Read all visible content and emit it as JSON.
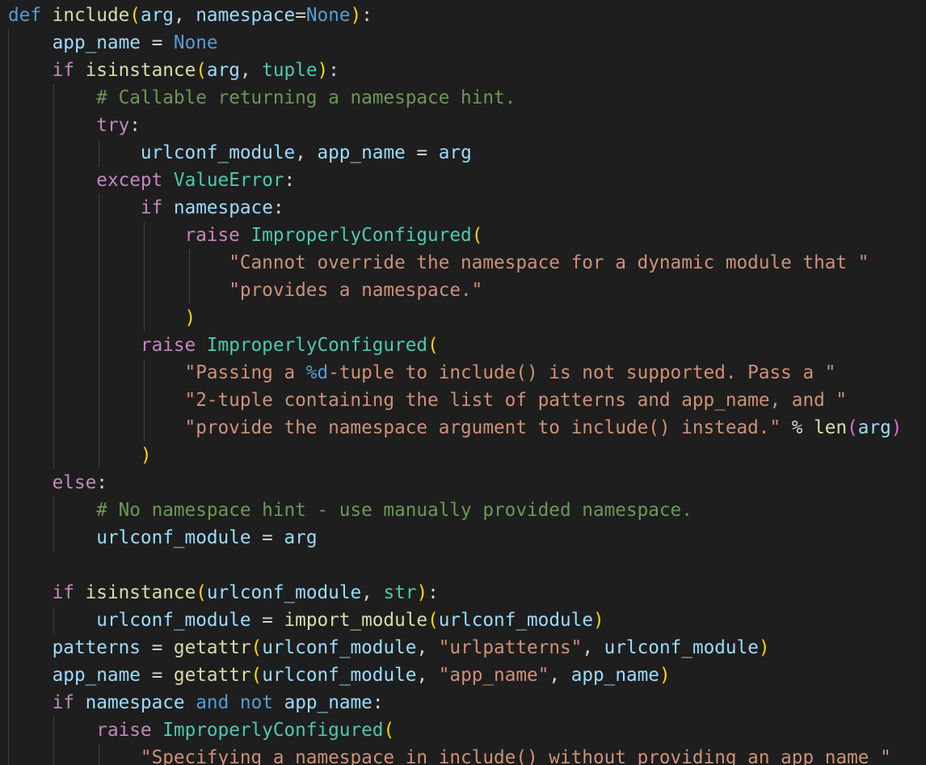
{
  "editor": {
    "language": "python",
    "theme_colors": {
      "background": "#1e1e1e",
      "default": "#d4d4d4",
      "keyword": "#569cd6",
      "control": "#c586c0",
      "function": "#dcdcaa",
      "variable": "#9cdcfe",
      "string": "#ce9178",
      "class": "#4ec9b0",
      "comment": "#6a9955",
      "bracket_level_1": "#ffd700",
      "bracket_level_2": "#da70d6",
      "indent_guide": "#404040"
    },
    "lines": [
      {
        "tokens": [
          {
            "t": "def",
            "c": "kw"
          },
          {
            "t": " "
          },
          {
            "t": "include",
            "c": "fn"
          },
          {
            "t": "(",
            "c": "b1"
          },
          {
            "t": "arg",
            "c": "var"
          },
          {
            "t": ", "
          },
          {
            "t": "namespace",
            "c": "var"
          },
          {
            "t": "="
          },
          {
            "t": "None",
            "c": "kw"
          },
          {
            "t": ")",
            "c": "b1"
          },
          {
            "t": ":"
          }
        ]
      },
      {
        "tokens": [
          {
            "t": "    "
          },
          {
            "t": "app_name",
            "c": "var"
          },
          {
            "t": " = "
          },
          {
            "t": "None",
            "c": "kw"
          }
        ]
      },
      {
        "tokens": [
          {
            "t": "    "
          },
          {
            "t": "if",
            "c": "ctrl"
          },
          {
            "t": " "
          },
          {
            "t": "isinstance",
            "c": "fn"
          },
          {
            "t": "(",
            "c": "b1"
          },
          {
            "t": "arg",
            "c": "var"
          },
          {
            "t": ", "
          },
          {
            "t": "tuple",
            "c": "cls"
          },
          {
            "t": ")",
            "c": "b1"
          },
          {
            "t": ":"
          }
        ]
      },
      {
        "tokens": [
          {
            "t": "        "
          },
          {
            "t": "# Callable returning a namespace hint.",
            "c": "cm"
          }
        ]
      },
      {
        "tokens": [
          {
            "t": "        "
          },
          {
            "t": "try",
            "c": "ctrl"
          },
          {
            "t": ":"
          }
        ]
      },
      {
        "tokens": [
          {
            "t": "            "
          },
          {
            "t": "urlconf_module",
            "c": "var"
          },
          {
            "t": ", "
          },
          {
            "t": "app_name",
            "c": "var"
          },
          {
            "t": " = "
          },
          {
            "t": "arg",
            "c": "var"
          }
        ]
      },
      {
        "tokens": [
          {
            "t": "        "
          },
          {
            "t": "except",
            "c": "ctrl"
          },
          {
            "t": " "
          },
          {
            "t": "ValueError",
            "c": "cls"
          },
          {
            "t": ":"
          }
        ]
      },
      {
        "tokens": [
          {
            "t": "            "
          },
          {
            "t": "if",
            "c": "ctrl"
          },
          {
            "t": " "
          },
          {
            "t": "namespace",
            "c": "var"
          },
          {
            "t": ":"
          }
        ]
      },
      {
        "tokens": [
          {
            "t": "                "
          },
          {
            "t": "raise",
            "c": "ctrl"
          },
          {
            "t": " "
          },
          {
            "t": "ImproperlyConfigured",
            "c": "cls"
          },
          {
            "t": "(",
            "c": "b1"
          }
        ]
      },
      {
        "tokens": [
          {
            "t": "                    "
          },
          {
            "t": "\"Cannot override the namespace for a dynamic module that \"",
            "c": "str"
          }
        ]
      },
      {
        "tokens": [
          {
            "t": "                    "
          },
          {
            "t": "\"provides a namespace.\"",
            "c": "str"
          }
        ]
      },
      {
        "tokens": [
          {
            "t": "                "
          },
          {
            "t": ")",
            "c": "b1"
          }
        ]
      },
      {
        "tokens": [
          {
            "t": "            "
          },
          {
            "t": "raise",
            "c": "ctrl"
          },
          {
            "t": " "
          },
          {
            "t": "ImproperlyConfigured",
            "c": "cls"
          },
          {
            "t": "(",
            "c": "b1"
          }
        ]
      },
      {
        "tokens": [
          {
            "t": "                "
          },
          {
            "t": "\"Passing a ",
            "c": "str"
          },
          {
            "t": "%d",
            "c": "kw"
          },
          {
            "t": "-tuple to include() is not supported. Pass a \"",
            "c": "str"
          }
        ]
      },
      {
        "tokens": [
          {
            "t": "                "
          },
          {
            "t": "\"2-tuple containing the list of patterns and app_name, and \"",
            "c": "str"
          }
        ]
      },
      {
        "tokens": [
          {
            "t": "                "
          },
          {
            "t": "\"provide the namespace argument to include() instead.\"",
            "c": "str"
          },
          {
            "t": " % "
          },
          {
            "t": "len",
            "c": "fn"
          },
          {
            "t": "(",
            "c": "b2"
          },
          {
            "t": "arg",
            "c": "var"
          },
          {
            "t": ")",
            "c": "b2"
          }
        ]
      },
      {
        "tokens": [
          {
            "t": "            "
          },
          {
            "t": ")",
            "c": "b1"
          }
        ]
      },
      {
        "tokens": [
          {
            "t": "    "
          },
          {
            "t": "else",
            "c": "ctrl"
          },
          {
            "t": ":"
          }
        ]
      },
      {
        "tokens": [
          {
            "t": "        "
          },
          {
            "t": "# No namespace hint - use manually provided namespace.",
            "c": "cm"
          }
        ]
      },
      {
        "tokens": [
          {
            "t": "        "
          },
          {
            "t": "urlconf_module",
            "c": "var"
          },
          {
            "t": " = "
          },
          {
            "t": "arg",
            "c": "var"
          }
        ]
      },
      {
        "tokens": []
      },
      {
        "tokens": [
          {
            "t": "    "
          },
          {
            "t": "if",
            "c": "ctrl"
          },
          {
            "t": " "
          },
          {
            "t": "isinstance",
            "c": "fn"
          },
          {
            "t": "(",
            "c": "b1"
          },
          {
            "t": "urlconf_module",
            "c": "var"
          },
          {
            "t": ", "
          },
          {
            "t": "str",
            "c": "cls"
          },
          {
            "t": ")",
            "c": "b1"
          },
          {
            "t": ":"
          }
        ]
      },
      {
        "tokens": [
          {
            "t": "        "
          },
          {
            "t": "urlconf_module",
            "c": "var"
          },
          {
            "t": " = "
          },
          {
            "t": "import_module",
            "c": "fn"
          },
          {
            "t": "(",
            "c": "b1"
          },
          {
            "t": "urlconf_module",
            "c": "var"
          },
          {
            "t": ")",
            "c": "b1"
          }
        ]
      },
      {
        "tokens": [
          {
            "t": "    "
          },
          {
            "t": "patterns",
            "c": "var"
          },
          {
            "t": " = "
          },
          {
            "t": "getattr",
            "c": "fn"
          },
          {
            "t": "(",
            "c": "b1"
          },
          {
            "t": "urlconf_module",
            "c": "var"
          },
          {
            "t": ", "
          },
          {
            "t": "\"urlpatterns\"",
            "c": "str"
          },
          {
            "t": ", "
          },
          {
            "t": "urlconf_module",
            "c": "var"
          },
          {
            "t": ")",
            "c": "b1"
          }
        ]
      },
      {
        "tokens": [
          {
            "t": "    "
          },
          {
            "t": "app_name",
            "c": "var"
          },
          {
            "t": " = "
          },
          {
            "t": "getattr",
            "c": "fn"
          },
          {
            "t": "(",
            "c": "b1"
          },
          {
            "t": "urlconf_module",
            "c": "var"
          },
          {
            "t": ", "
          },
          {
            "t": "\"app_name\"",
            "c": "str"
          },
          {
            "t": ", "
          },
          {
            "t": "app_name",
            "c": "var"
          },
          {
            "t": ")",
            "c": "b1"
          }
        ]
      },
      {
        "tokens": [
          {
            "t": "    "
          },
          {
            "t": "if",
            "c": "ctrl"
          },
          {
            "t": " "
          },
          {
            "t": "namespace",
            "c": "var"
          },
          {
            "t": " "
          },
          {
            "t": "and",
            "c": "kw"
          },
          {
            "t": " "
          },
          {
            "t": "not",
            "c": "kw"
          },
          {
            "t": " "
          },
          {
            "t": "app_name",
            "c": "var"
          },
          {
            "t": ":"
          }
        ]
      },
      {
        "tokens": [
          {
            "t": "        "
          },
          {
            "t": "raise",
            "c": "ctrl"
          },
          {
            "t": " "
          },
          {
            "t": "ImproperlyConfigured",
            "c": "cls"
          },
          {
            "t": "(",
            "c": "b1"
          }
        ]
      },
      {
        "tokens": [
          {
            "t": "            "
          },
          {
            "t": "\"Specifying a namespace in include() without providing an app_name \"",
            "c": "str"
          }
        ]
      }
    ]
  }
}
